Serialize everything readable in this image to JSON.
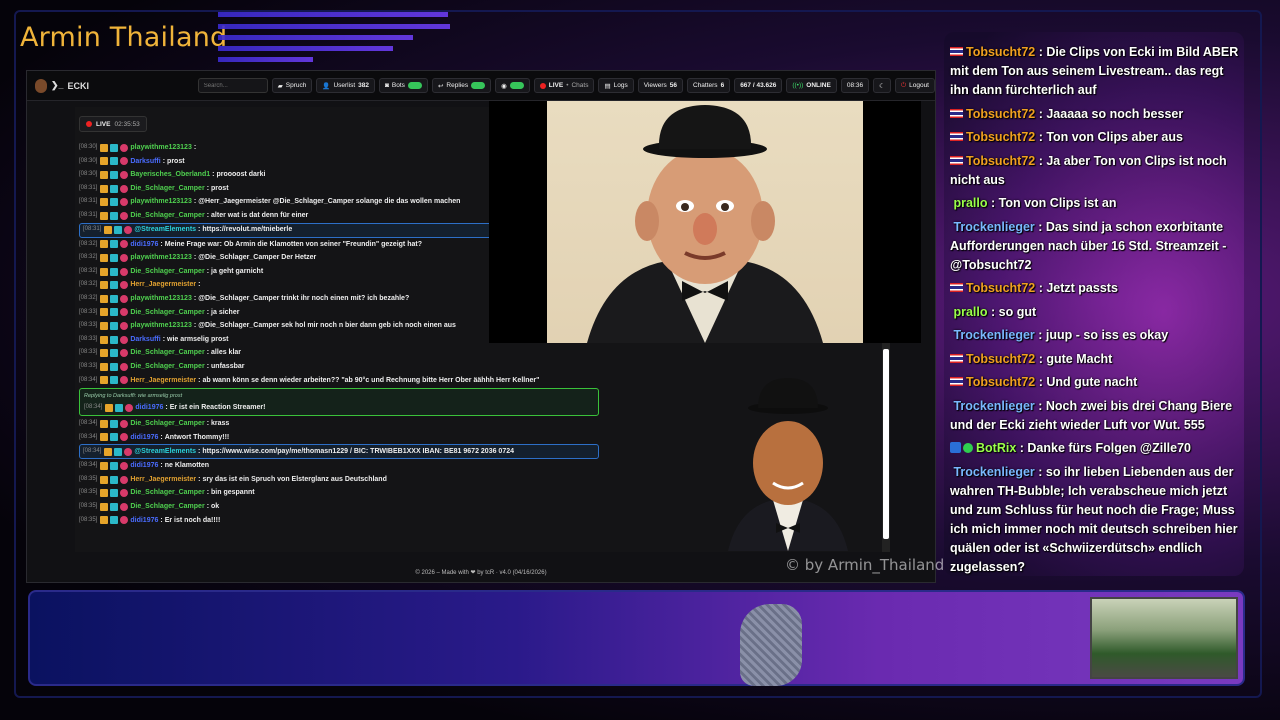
{
  "stream_title": "Armin Thailand",
  "app": {
    "name": "ECKI",
    "search_placeholder": "Search...",
    "buttons": {
      "spruch": "Spruch",
      "userlist": "Userlist",
      "userlist_count": "382",
      "bots": "Bots",
      "replies": "Replies",
      "live": "LIVE",
      "chats": "Chats",
      "logs": "Logs",
      "viewers": "Viewers",
      "viewers_count": "56",
      "chatters": "Chatters",
      "chatters_count": "6",
      "ratio": "667 / 43.626",
      "online": "ONLINE",
      "clock": "08:36",
      "logout": "Logout"
    },
    "live_badge": "LIVE",
    "live_time": "02:35:53",
    "footer": "© 2026 – Made with ❤ by tcR · v4.0 (04/16/2026)"
  },
  "chat_messages": [
    {
      "time": "[08:30]",
      "user": "playwithme123123",
      "color": "#4fd04f",
      "text": ""
    },
    {
      "time": "[08:30]",
      "user": "Darksuffi",
      "color": "#4a6cff",
      "text": "prost"
    },
    {
      "time": "[08:30]",
      "user": "Bayerisches_Oberland1",
      "color": "#4fd04f",
      "text": "proooost darki"
    },
    {
      "time": "[08:31]",
      "user": "Die_Schlager_Camper",
      "color": "#4fd04f",
      "text": "prost"
    },
    {
      "time": "[08:31]",
      "user": "playwithme123123",
      "color": "#4fd04f",
      "text": "@Herr_Jaegermeister @Die_Schlager_Camper solange die das wollen machen"
    },
    {
      "time": "[08:31]",
      "user": "Die_Schlager_Camper",
      "color": "#4fd04f",
      "text": "alter wat is dat denn für einer"
    },
    {
      "time": "[08:31]",
      "user": "@StreamElements",
      "color": "#2bd0d8",
      "text": "https://revolut.me/tnieberle",
      "hl": true
    },
    {
      "time": "[08:32]",
      "user": "didi1976",
      "color": "#4a6cff",
      "text": "Meine Frage war: Ob Armin die Klamotten von seiner \"Freundin\" gezeigt hat?"
    },
    {
      "time": "[08:32]",
      "user": "playwithme123123",
      "color": "#4fd04f",
      "text": "@Die_Schlager_Camper Der Hetzer"
    },
    {
      "time": "[08:32]",
      "user": "Die_Schlager_Camper",
      "color": "#4fd04f",
      "text": "ja geht garnicht"
    },
    {
      "time": "[08:32]",
      "user": "Herr_Jaegermeister",
      "color": "#e0a030",
      "text": ""
    },
    {
      "time": "[08:32]",
      "user": "playwithme123123",
      "color": "#4fd04f",
      "text": "@Die_Schlager_Camper trinkt ihr noch einen mit? ich bezahle?"
    },
    {
      "time": "[08:33]",
      "user": "Die_Schlager_Camper",
      "color": "#4fd04f",
      "text": "ja sicher"
    },
    {
      "time": "[08:33]",
      "user": "playwithme123123",
      "color": "#4fd04f",
      "text": "@Die_Schlager_Camper sek hol mir noch n bier dann geb ich noch einen aus"
    },
    {
      "time": "[08:33]",
      "user": "Darksuffi",
      "color": "#4a6cff",
      "text": "wie armselig prost"
    },
    {
      "time": "[08:33]",
      "user": "Die_Schlager_Camper",
      "color": "#4fd04f",
      "text": "alles klar"
    },
    {
      "time": "[08:33]",
      "user": "Die_Schlager_Camper",
      "color": "#4fd04f",
      "text": "unfassbar"
    },
    {
      "time": "[08:34]",
      "user": "Herr_Jaegermeister",
      "color": "#e0a030",
      "text": "ab wann könn se denn wieder arbeiten?? \"ab 90°c und Rechnung bitte Herr Ober äähhh Herr Kellner\""
    }
  ],
  "reply_block": {
    "reply_to": "Replying to Darksuffi: wie armselig prost",
    "time": "[08:34]",
    "user": "didi1976",
    "text": "Er ist ein Reaction Streamer!"
  },
  "chat_messages_2": [
    {
      "time": "[08:34]",
      "user": "Die_Schlager_Camper",
      "color": "#4fd04f",
      "text": "krass"
    },
    {
      "time": "[08:34]",
      "user": "didi1976",
      "color": "#4a6cff",
      "text": "Antwort Thommy!!!"
    },
    {
      "time": "[08:34]",
      "user": "@StreamElements",
      "color": "#2bd0d8",
      "text": "https://www.wise.com/pay/me/thomasn1229 / BIC: TRWIBEB1XXX IBAN: BE81 9672 2036 0724",
      "hl": true
    },
    {
      "time": "[08:34]",
      "user": "didi1976",
      "color": "#4a6cff",
      "text": "ne Klamotten"
    },
    {
      "time": "[08:35]",
      "user": "Herr_Jaegermeister",
      "color": "#e0a030",
      "text": "sry das ist ein Spruch von Elsterglanz aus Deutschland"
    },
    {
      "time": "[08:35]",
      "user": "Die_Schlager_Camper",
      "color": "#4fd04f",
      "text": "bin gespannt"
    },
    {
      "time": "[08:35]",
      "user": "Die_Schlager_Camper",
      "color": "#4fd04f",
      "text": "ok"
    },
    {
      "time": "[08:35]",
      "user": "didi1976",
      "color": "#4a6cff",
      "text": "Er ist noch da!!!!"
    }
  ],
  "watermark": "© by Armin_Thailand",
  "right_chat": [
    {
      "user": "Tobsucht72",
      "color": "#f0a020",
      "flag": true,
      "text": "Die Clips von Ecki im Bild ABER mit dem Ton aus seinem Livestream.. das regt ihn dann fürchterlich auf",
      "lines": 3
    },
    {
      "user": "Tobsucht72",
      "color": "#f0a020",
      "flag": true,
      "text": "Jaaaaa so noch besser",
      "lines": 1
    },
    {
      "user": "Tobsucht72",
      "color": "#f0a020",
      "flag": true,
      "text": "Ton von Clips aber aus",
      "lines": 1
    },
    {
      "user": "Tobsucht72",
      "color": "#f0a020",
      "flag": true,
      "text": "Ja aber Ton von Clips ist noch nicht aus",
      "lines": 2
    },
    {
      "user": "prallo",
      "color": "#9aff4a",
      "flag": false,
      "text": "Ton von Clips ist an",
      "lines": 1
    },
    {
      "user": "Trockenlieger",
      "color": "#7ab8ff",
      "flag": false,
      "text": "Das sind ja schon exorbitante Aufforderungen nach über 16 Std. Streamzeit - @Tobsucht72",
      "lines": 3
    },
    {
      "user": "Tobsucht72",
      "color": "#f0a020",
      "flag": true,
      "text": "Jetzt passts",
      "lines": 1
    },
    {
      "user": "prallo",
      "color": "#9aff4a",
      "flag": false,
      "text": "so gut",
      "lines": 1
    },
    {
      "user": "Trockenlieger",
      "color": "#7ab8ff",
      "flag": false,
      "text": "juup - so iss es okay",
      "lines": 1
    },
    {
      "user": "Tobsucht72",
      "color": "#f0a020",
      "flag": true,
      "text": "gute Macht",
      "lines": 1
    },
    {
      "user": "Tobsucht72",
      "color": "#f0a020",
      "flag": true,
      "text": "Und gute nacht",
      "lines": 1
    },
    {
      "user": "Trockenlieger",
      "color": "#7ab8ff",
      "flag": false,
      "text": "Noch zwei bis drei Chang Biere und der Ecki zieht wieder Luft vor Wut. 555",
      "lines": 2
    },
    {
      "user": "BotRix",
      "color": "#9aff4a",
      "flag": false,
      "bot": true,
      "text": "Danke fürs Folgen @Zille70",
      "lines": 1
    },
    {
      "user": "Trockenlieger",
      "color": "#7ab8ff",
      "flag": false,
      "text": "so ihr lieben Liebenden aus der wahren TH-Bubble; Ich verabscheue mich jetzt und zum Schluss für heut noch die Frage; Muss ich mich immer noch mit deutsch schreiben hier quälen oder ist «Schwiizerdütsch» endlich zugelassen?",
      "lines": 5
    }
  ]
}
